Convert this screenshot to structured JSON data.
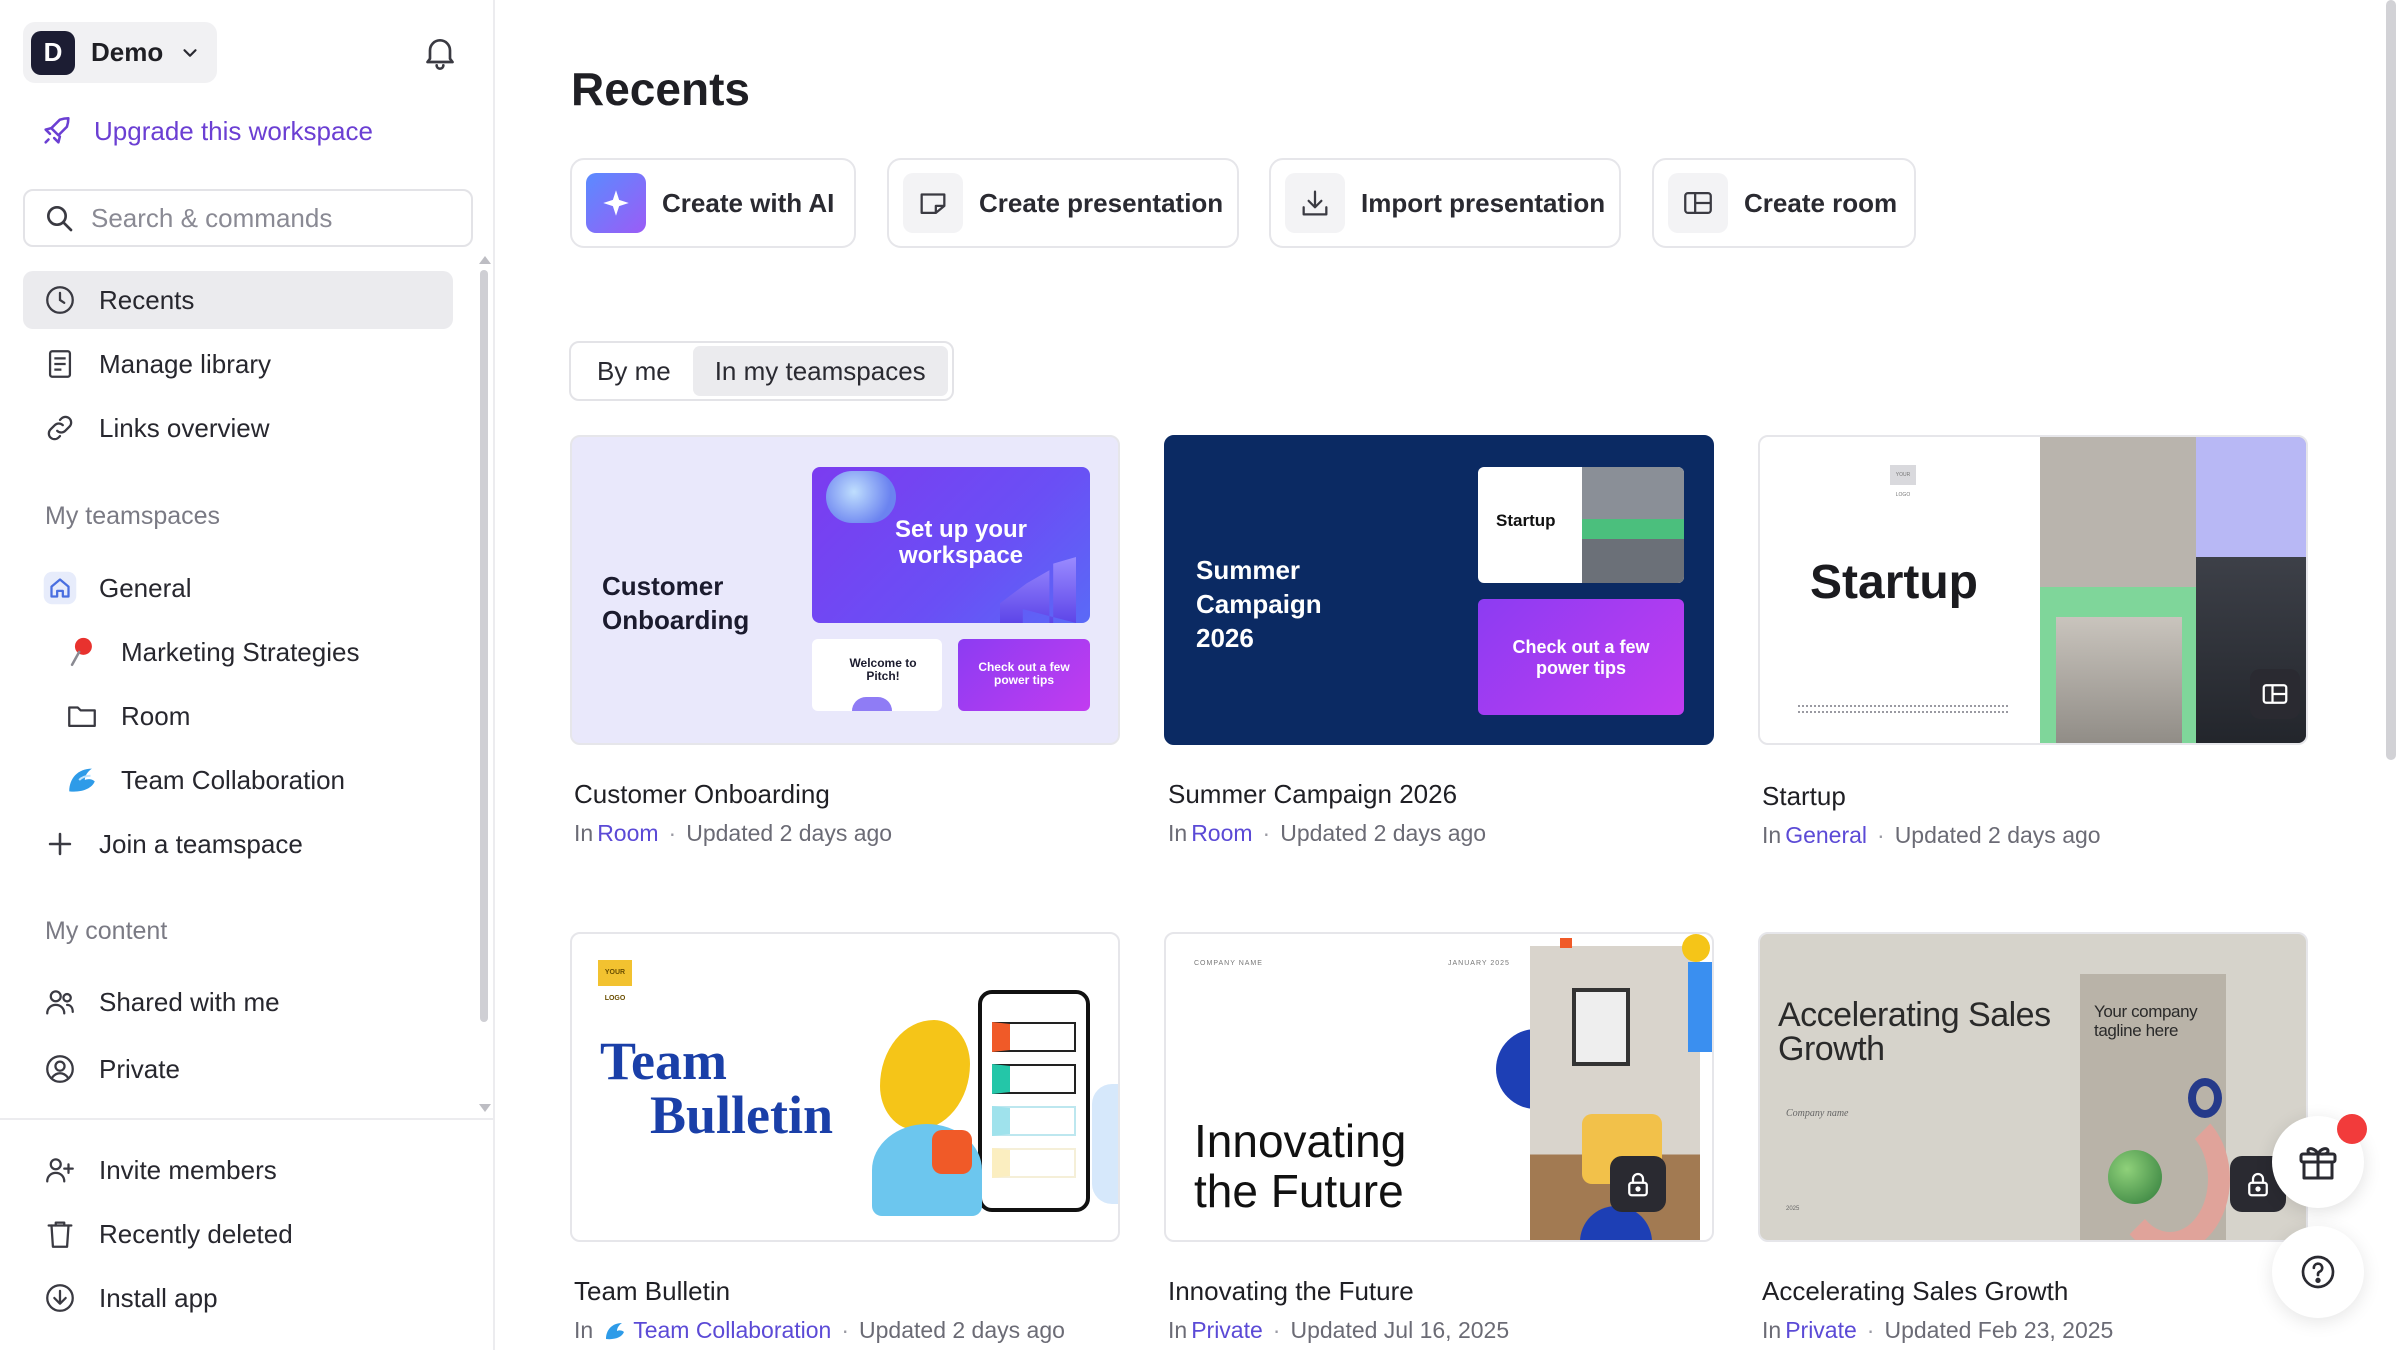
{
  "workspace": {
    "initial": "D",
    "name": "Demo"
  },
  "sidebar": {
    "upgrade_label": "Upgrade this workspace",
    "search_placeholder": "Search & commands",
    "nav": [
      {
        "label": "Recents",
        "icon": "clock-icon",
        "active": true
      },
      {
        "label": "Manage library",
        "icon": "library-icon"
      },
      {
        "label": "Links overview",
        "icon": "link-icon"
      }
    ],
    "teamspaces_label": "My teamspaces",
    "teamspaces": [
      {
        "label": "General",
        "icon": "home-icon"
      },
      {
        "label": "Marketing Strategies",
        "icon": "pushpin-icon"
      },
      {
        "label": "Room",
        "icon": "folder-icon"
      },
      {
        "label": "Team Collaboration",
        "icon": "wave-icon"
      }
    ],
    "join_label": "Join a teamspace",
    "content_label": "My content",
    "content": [
      {
        "label": "Shared with me",
        "icon": "people-icon"
      },
      {
        "label": "Private",
        "icon": "user-circle-icon"
      }
    ],
    "footer": [
      {
        "label": "Invite members",
        "icon": "user-plus-icon"
      },
      {
        "label": "Recently deleted",
        "icon": "trash-icon"
      },
      {
        "label": "Install app",
        "icon": "download-icon"
      }
    ]
  },
  "main": {
    "title": "Recents",
    "actions": [
      {
        "label": "Create with AI",
        "icon": "sparkle-icon"
      },
      {
        "label": "Create presentation",
        "icon": "presentation-icon"
      },
      {
        "label": "Import presentation",
        "icon": "import-icon"
      },
      {
        "label": "Create room",
        "icon": "room-icon"
      }
    ],
    "filter": {
      "by_me": "By me",
      "in_teamspaces": "In my teamspaces",
      "selected": "In my teamspaces"
    },
    "cards": [
      {
        "title": "Customer Onboarding",
        "in": "In",
        "location": "Room",
        "updated": "Updated 2 days ago",
        "thumb": {
          "headline": "Customer Onboarding",
          "panel_main": "Set up your workspace",
          "panel_a": "Welcome to Pitch!",
          "panel_b": "Check out a few power tips"
        }
      },
      {
        "title": "Summer Campaign 2026",
        "in": "In",
        "location": "Room",
        "updated": "Updated 2 days ago",
        "thumb": {
          "headline": "Summer Campaign 2026",
          "panel_a": "Startup",
          "panel_b": "Check out a few power tips"
        }
      },
      {
        "title": "Startup",
        "in": "In",
        "location": "General",
        "updated": "Updated 2 days ago",
        "thumb": {
          "headline": "Startup",
          "logo": "YOUR LOGO"
        }
      },
      {
        "title": "Team Bulletin",
        "in": "In",
        "location": "Team Collaboration",
        "updated": "Updated 2 days ago",
        "thumb": {
          "headline_1": "Team",
          "headline_2": "Bulletin",
          "logo": "YOUR LOGO"
        }
      },
      {
        "title": "Innovating the Future",
        "in": "In",
        "location": "Private",
        "updated": "Updated Jul 16, 2025",
        "thumb": {
          "headline_1": "Innovating",
          "headline_2": "the Future",
          "company": "COMPANY NAME",
          "date": "JANUARY 2025"
        }
      },
      {
        "title": "Accelerating Sales Growth",
        "in": "In",
        "location": "Private",
        "updated": "Updated Feb 23, 2025",
        "thumb": {
          "headline": "Accelerating Sales Growth",
          "tagline": "Your company tagline here",
          "company": "Company name",
          "year": "2025"
        }
      }
    ]
  },
  "colors": {
    "accent": "#6b3fd3",
    "link": "#5b4ad6",
    "notification": "#f23b3b"
  }
}
